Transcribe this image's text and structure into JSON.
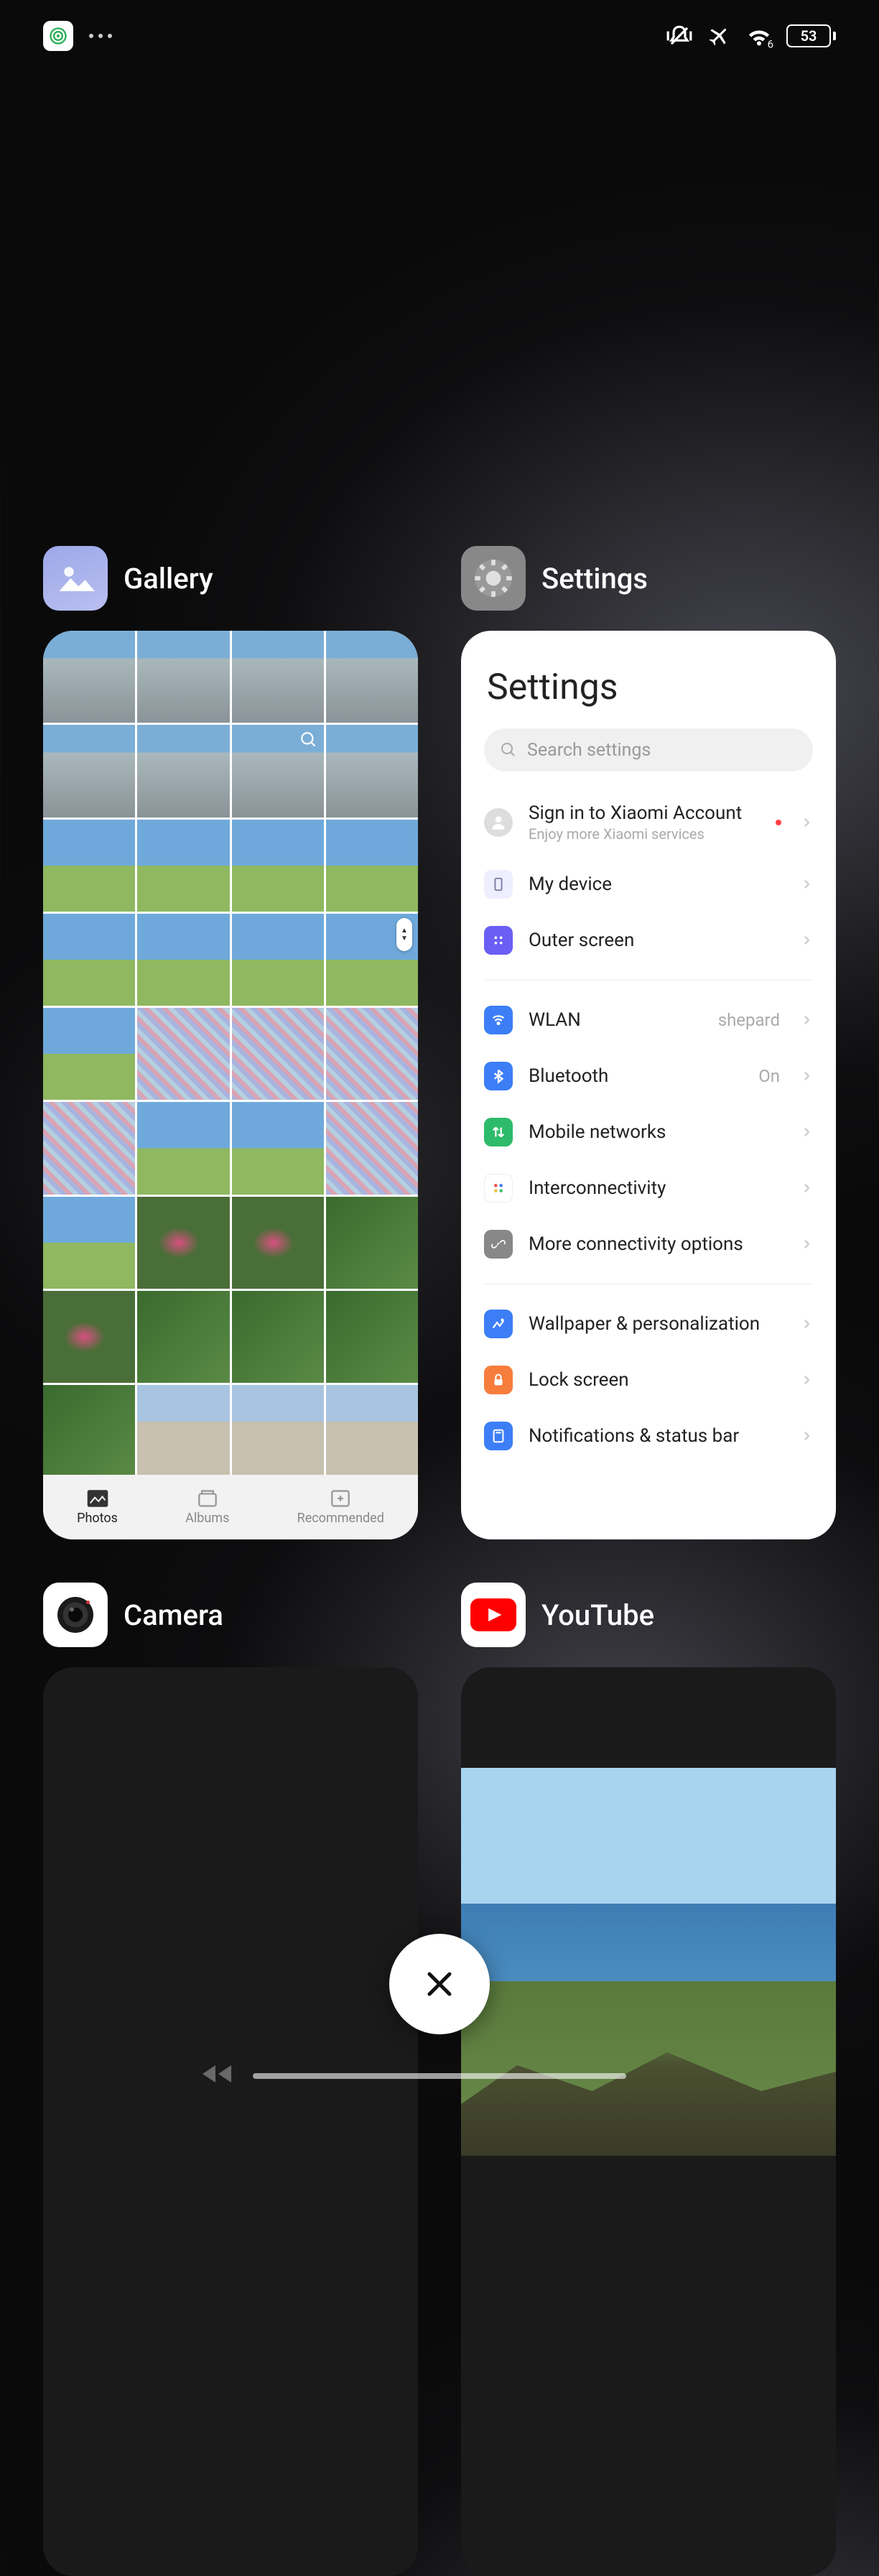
{
  "status": {
    "battery": "53"
  },
  "cards": {
    "gallery": {
      "title": "Gallery",
      "tabs": {
        "photos": "Photos",
        "albums": "Albums",
        "recommended": "Recommended"
      }
    },
    "settings": {
      "title": "Settings",
      "heading": "Settings",
      "search_placeholder": "Search settings",
      "account": {
        "title": "Sign in to Xiaomi Account",
        "sub": "Enjoy more Xiaomi services"
      },
      "items": {
        "mydevice": "My device",
        "outerscreen": "Outer screen",
        "wlan": "WLAN",
        "wlan_val": "shepard",
        "bluetooth": "Bluetooth",
        "bluetooth_val": "On",
        "mobile": "Mobile networks",
        "interconn": "Interconnectivity",
        "moreconn": "More connectivity options",
        "wallpaper": "Wallpaper & personalization",
        "lockscreen": "Lock screen",
        "notifications": "Notifications & status bar"
      }
    },
    "camera": {
      "title": "Camera"
    },
    "youtube": {
      "title": "YouTube"
    }
  }
}
